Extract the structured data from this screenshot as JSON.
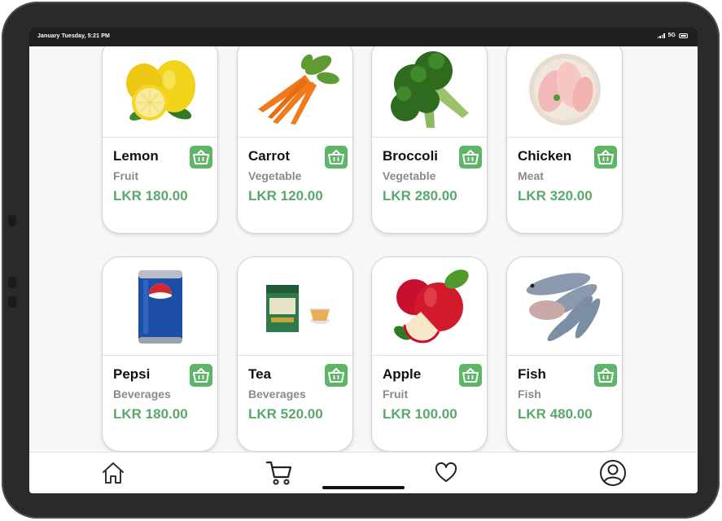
{
  "status_bar": {
    "time": "January Tuesday, 5:21 PM",
    "network": "5G"
  },
  "products": [
    {
      "name": "Lemon",
      "category": "Fruit",
      "price": "LKR 180.00",
      "image": "lemon"
    },
    {
      "name": "Carrot",
      "category": "Vegetable",
      "price": "LKR 120.00",
      "image": "carrot"
    },
    {
      "name": "Broccoli",
      "category": "Vegetable",
      "price": "LKR 280.00",
      "image": "broccoli"
    },
    {
      "name": "Chicken",
      "category": "Meat",
      "price": "LKR 320.00",
      "image": "chicken"
    },
    {
      "name": "Pepsi",
      "category": "Beverages",
      "price": "LKR 180.00",
      "image": "pepsi-can"
    },
    {
      "name": "Tea",
      "category": "Beverages",
      "price": "LKR 520.00",
      "image": "tea-box"
    },
    {
      "name": "Apple",
      "category": "Fruit",
      "price": "LKR 100.00",
      "image": "apple"
    },
    {
      "name": "Fish",
      "category": "Fish",
      "price": "LKR 480.00",
      "image": "fish"
    }
  ],
  "nav": [
    "home-icon",
    "cart-icon",
    "heart-icon",
    "profile-icon"
  ],
  "colors": {
    "accent": "#5db665",
    "price": "#5aa86a",
    "bezel": "#2a2a2a"
  }
}
